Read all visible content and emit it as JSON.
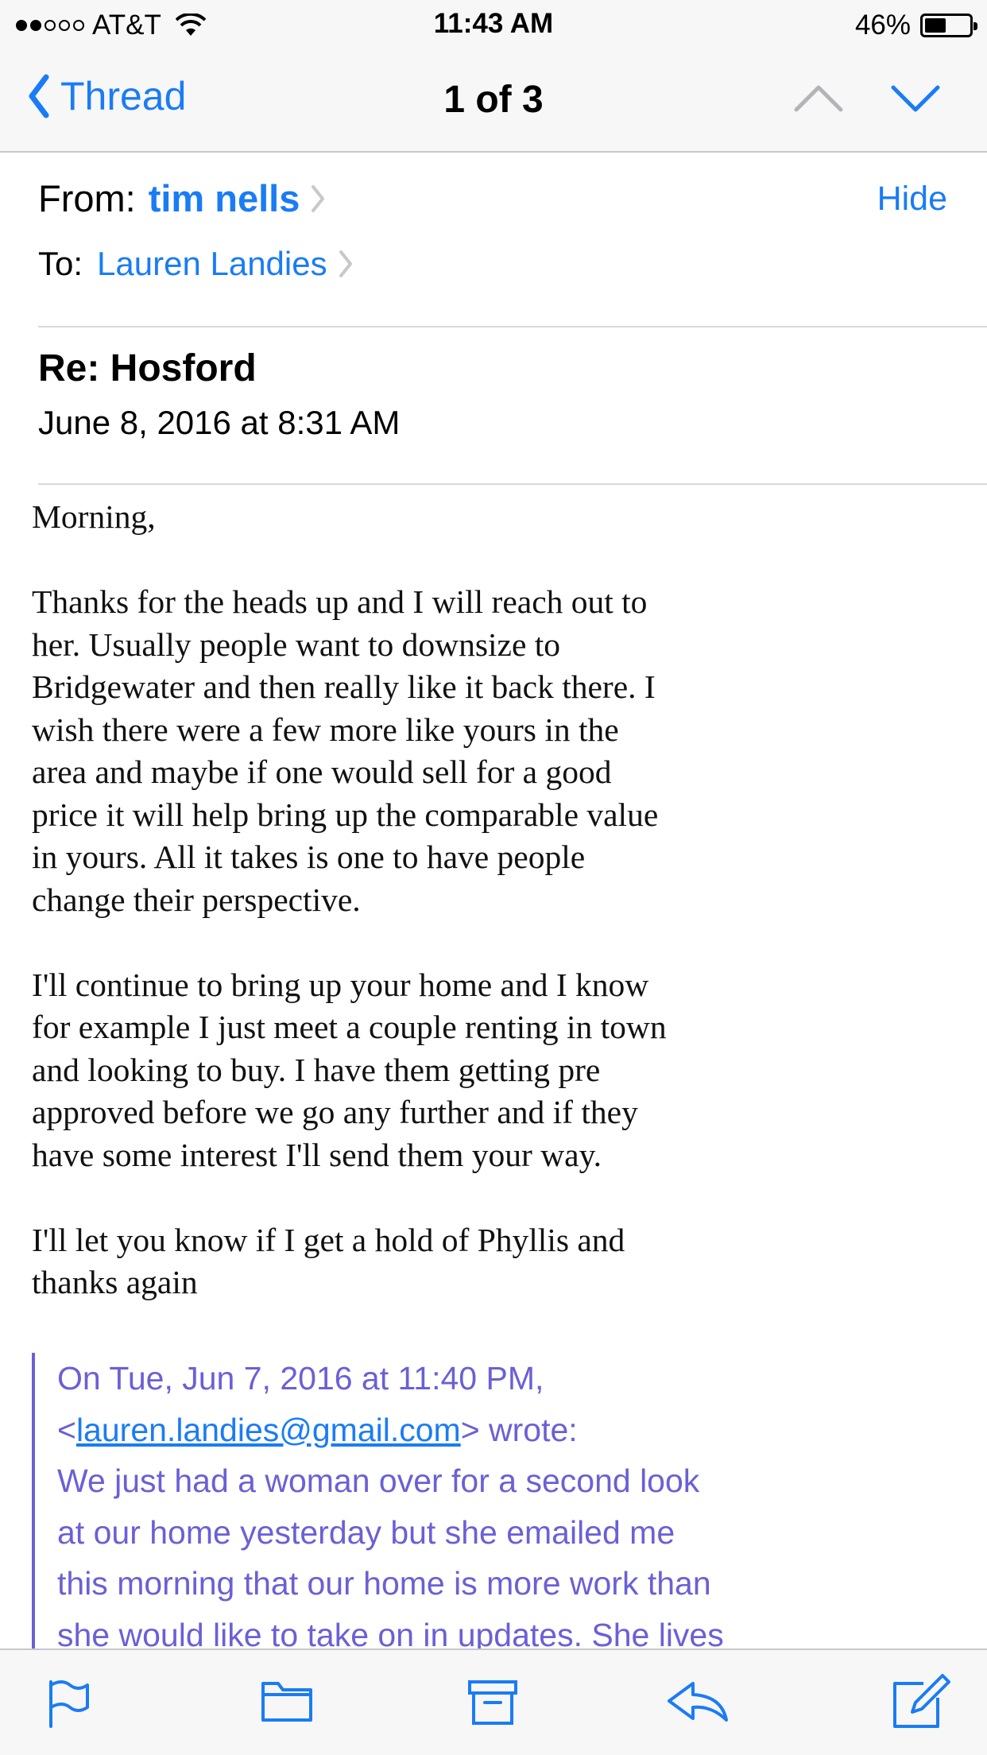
{
  "status": {
    "carrier": "AT&T",
    "time": "11:43 AM",
    "battery": "46%",
    "signal_bars_filled": 2,
    "signal_bars_total": 5
  },
  "nav": {
    "back_label": "Thread",
    "title": "1 of 3"
  },
  "header": {
    "from_label": "From:",
    "from_name": "tim nells",
    "to_label": "To:",
    "to_name": "Lauren Landies",
    "hide_label": "Hide",
    "subject": "Re: Hosford",
    "date": "June 8, 2016 at 8:31 AM"
  },
  "body": {
    "greeting": "Morning,",
    "para1": "Thanks for the heads up and I will reach out to\nher. Usually people want to downsize to\nBridgewater and then really like it back there. I\nwish there were a few more like yours in the\narea and maybe if one would sell for a good\nprice it will help bring up the comparable value\nin yours. All it takes is one to have people\nchange their perspective.",
    "para2": "I'll continue to bring up your home and I know\nfor example I just meet a couple renting in town\nand looking to buy. I have them getting pre\napproved before we go any further and if they\nhave some interest I'll send them your way.",
    "para3": "I'll let you know if I get a hold of Phyllis and\nthanks again"
  },
  "quote": {
    "line1": "On Tue, Jun 7, 2016 at 11:40 PM,",
    "email_prefix": "<",
    "email": "lauren.landies@gmail.com",
    "email_suffix": "> wrote:",
    "text": "We just had a woman over for a second look\nat our home yesterday but she emailed me\nthis morning that our home is more work than\nshe would like to take on in updates. She lives"
  },
  "colors": {
    "accent": "#1a7cf5",
    "quote": "#6a60d6",
    "bar_bg": "#f7f7f8"
  },
  "toolbar": {
    "icons": [
      "flag-icon",
      "folder-icon",
      "archive-icon",
      "reply-icon",
      "compose-icon"
    ]
  }
}
